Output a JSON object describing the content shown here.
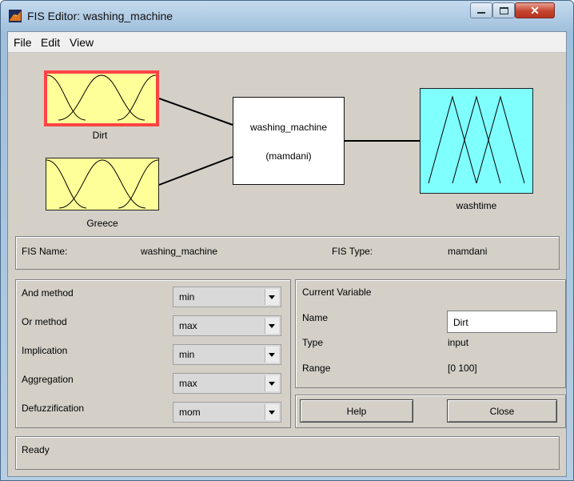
{
  "window": {
    "title": "FIS Editor: washing_machine",
    "controls": [
      "minimize",
      "maximize",
      "close"
    ]
  },
  "menubar": {
    "file": "File",
    "edit": "Edit",
    "view": "View"
  },
  "diagram": {
    "inputs": [
      {
        "name": "Dirt",
        "selected": true,
        "color": "#ffff99"
      },
      {
        "name": "Greece",
        "selected": false,
        "color": "#ffff99"
      }
    ],
    "system": {
      "name": "washing_machine",
      "type_label": "(mamdani)"
    },
    "output": {
      "name": "washtime",
      "color": "#80ffff"
    },
    "selection_color": "#ff4444"
  },
  "fis": {
    "name_label": "FIS Name:",
    "name_value": "washing_machine",
    "type_label": "FIS Type:",
    "type_value": "mamdani"
  },
  "methods": [
    {
      "label": "And method",
      "value": "min"
    },
    {
      "label": "Or method",
      "value": "max"
    },
    {
      "label": "Implication",
      "value": "min"
    },
    {
      "label": "Aggregation",
      "value": "max"
    },
    {
      "label": "Defuzzification",
      "value": "mom"
    }
  ],
  "current_variable": {
    "title": "Current Variable",
    "name_label": "Name",
    "name_value": "Dirt",
    "type_label": "Type",
    "type_value": "input",
    "range_label": "Range",
    "range_value": "[0 100]"
  },
  "buttons": {
    "help": "Help",
    "close": "Close"
  },
  "status": {
    "text": "Ready"
  }
}
